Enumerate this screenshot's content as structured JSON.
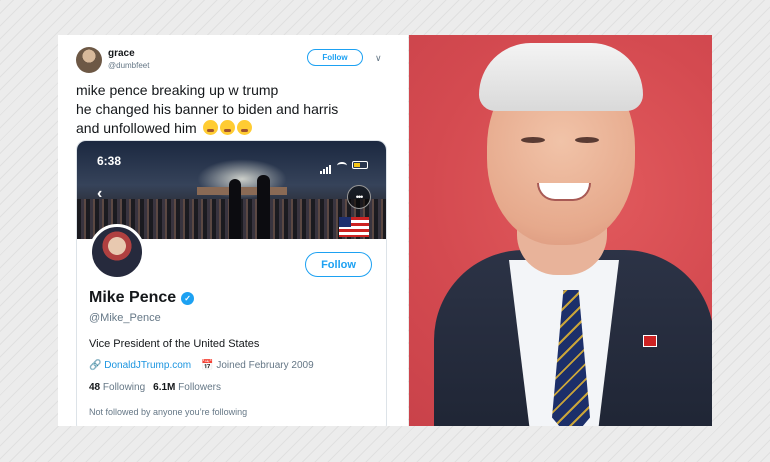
{
  "tweet": {
    "user_name": "grace",
    "user_handle": "@dumbfeet",
    "follow_label": "Follow",
    "text_lines": [
      "mike pence breaking up w trump",
      "he changed his banner to biden and harris",
      "and unfollowed him"
    ],
    "emoji": "loudly-crying-face"
  },
  "screenshot": {
    "time": "6:38",
    "follow_label": "Follow",
    "profile_name": "Mike Pence",
    "profile_handle": "@Mike_Pence",
    "bio": "Vice President of the United States",
    "link": "DonaldJTrump.com",
    "joined": "Joined February 2009",
    "following_count": "48",
    "following_label": "Following",
    "followers_count": "6.1M",
    "followers_label": "Followers",
    "note": "Not followed by anyone you’re following"
  },
  "colors": {
    "twitter_blue": "#1da1f2",
    "photo_background": "#d44a50"
  }
}
